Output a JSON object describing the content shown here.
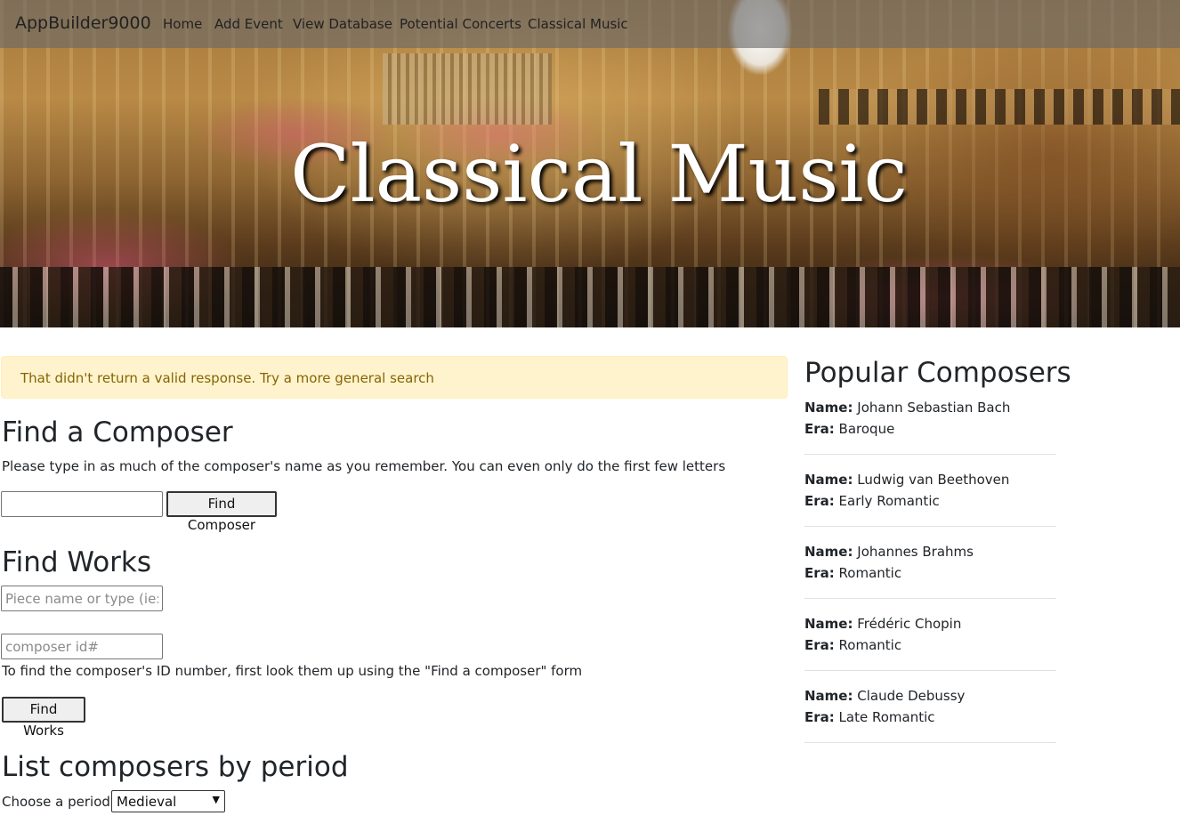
{
  "navbar": {
    "brand": "AppBuilder9000",
    "links": [
      "Home",
      "Add Event",
      "View Database",
      "Potential Concerts",
      "Classical Music"
    ]
  },
  "hero": {
    "title": "Classical Music"
  },
  "alert": {
    "message": "That didn't return a valid response. Try a more general search"
  },
  "find_composer": {
    "heading": "Find a Composer",
    "description": "Please type in as much of the composer's name as you remember. You can even only do the first few letters",
    "input_value": "",
    "button_label": "Find Composer"
  },
  "find_works": {
    "heading": "Find Works",
    "piece_placeholder": "Piece name or type (ie: sonata)",
    "composer_id_placeholder": "composer id#",
    "hint": "To find the composer's ID number, first look them up using the \"Find a composer\" form",
    "button_label": "Find Works"
  },
  "by_period": {
    "heading": "List composers by period",
    "label": "Choose a period:",
    "selected": "Medieval"
  },
  "sidebar": {
    "title": "Popular Composers",
    "name_label": "Name:",
    "era_label": "Era:",
    "composers": [
      {
        "name": "Johann Sebastian Bach",
        "era": "Baroque"
      },
      {
        "name": "Ludwig van Beethoven",
        "era": "Early Romantic"
      },
      {
        "name": "Johannes Brahms",
        "era": "Romantic"
      },
      {
        "name": "Frédéric Chopin",
        "era": "Romantic"
      },
      {
        "name": "Claude Debussy",
        "era": "Late Romantic"
      }
    ]
  }
}
